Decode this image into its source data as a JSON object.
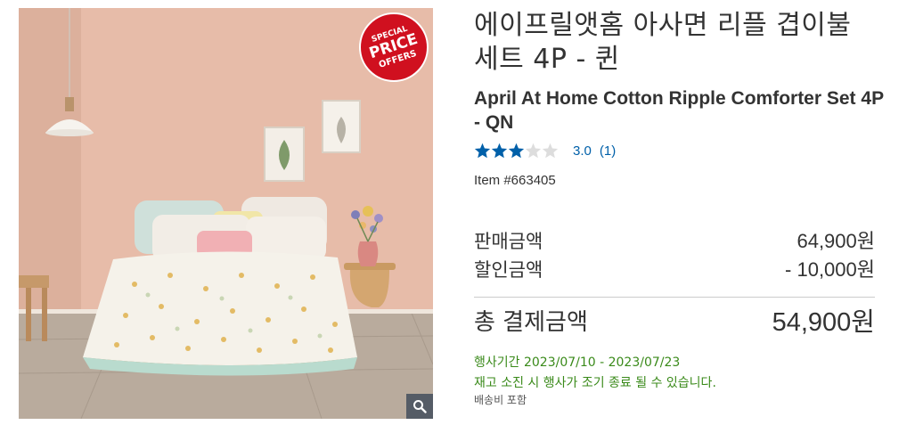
{
  "product": {
    "title_ko": "에이프릴앳홈 아사면 리플 겹이불 세트 4P - 퀸",
    "title_en": "April At Home Cotton Ripple Comforter Set 4P - QN",
    "item_number": "Item #663405",
    "image_alt": "Bedroom with cotton ripple comforter set",
    "badge": {
      "line1": "SPECIAL",
      "line2": "PRICE",
      "line3": "OFFERS",
      "color": "#d0101f"
    },
    "zoom_icon": "magnifier-icon"
  },
  "rating": {
    "value": "3.0",
    "count": "(1)",
    "stars_filled": 3,
    "stars_total": 5,
    "color": "#0060a9"
  },
  "pricing": {
    "sale_label": "판매금액",
    "sale_value": "64,900원",
    "discount_label": "할인금액",
    "discount_value": "- 10,000원",
    "total_label": "총 결제금액",
    "total_value": "54,900원"
  },
  "promotion": {
    "period": "행사기간 2023/07/10 - 2023/07/23",
    "note": "재고 소진 시 행사가 조기 종료 될 수 있습니다.",
    "color": "#3a8a1a"
  },
  "shipping": {
    "text": "배송비 포함"
  }
}
